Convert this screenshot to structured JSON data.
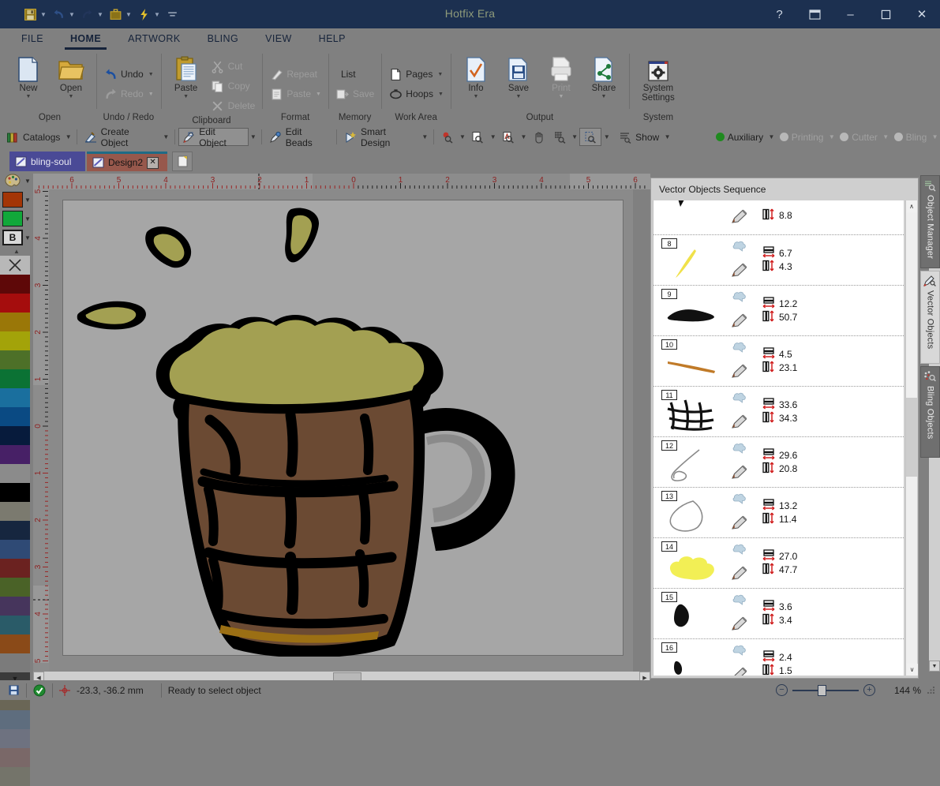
{
  "window": {
    "title": "Hotfix Era",
    "help_label": "?",
    "restore_down_label": "❐",
    "minimize_label": "–",
    "maximize_label": "☐",
    "close_label": "✕"
  },
  "quick_access": [
    {
      "name": "save",
      "icon": "floppy-disk-icon",
      "caret": true
    },
    {
      "name": "undo",
      "icon": "undo-arrow-icon",
      "caret": true
    },
    {
      "name": "redo",
      "icon": "redo-arrow-icon",
      "caret": true
    },
    {
      "name": "briefcase",
      "icon": "briefcase-icon",
      "caret": true
    },
    {
      "name": "quick-action",
      "icon": "lightning-bolt-icon",
      "caret": true
    },
    {
      "name": "customize",
      "icon": "customize-toolbar-icon",
      "caret": false
    }
  ],
  "ribbon_tabs": [
    {
      "label": "FILE",
      "active": false
    },
    {
      "label": "HOME",
      "active": true
    },
    {
      "label": "ARTWORK",
      "active": false
    },
    {
      "label": "BLING",
      "active": false
    },
    {
      "label": "VIEW",
      "active": false
    },
    {
      "label": "HELP",
      "active": false
    }
  ],
  "ribbon_groups": [
    {
      "label": "Open",
      "big_buttons": [
        {
          "label": "New",
          "icon": "new-document-icon",
          "caret": true,
          "disabled": false
        },
        {
          "label": "Open",
          "icon": "open-folder-icon",
          "caret": true,
          "disabled": false
        }
      ],
      "small_buttons": []
    },
    {
      "label": "Undo / Redo",
      "big_buttons": [],
      "small_buttons": [
        {
          "label": "Undo",
          "icon": "undo-arrow-icon",
          "caret": true,
          "disabled": false
        },
        {
          "label": "Redo",
          "icon": "redo-arrow-icon",
          "caret": true,
          "disabled": true
        }
      ]
    },
    {
      "label": "Clipboard",
      "big_buttons": [
        {
          "label": "Paste",
          "icon": "paste-clipboard-icon",
          "caret": true,
          "disabled": false
        }
      ],
      "small_buttons": [
        {
          "label": "Cut",
          "icon": "scissors-icon",
          "caret": false,
          "disabled": true
        },
        {
          "label": "Copy",
          "icon": "copy-pages-icon",
          "caret": false,
          "disabled": true
        },
        {
          "label": "Delete",
          "icon": "delete-x-icon",
          "caret": false,
          "disabled": true
        }
      ]
    },
    {
      "label": "Format",
      "big_buttons": [],
      "small_buttons": [
        {
          "label": "Repeat",
          "icon": "format-painter-icon",
          "caret": false,
          "disabled": true
        },
        {
          "label": "Paste",
          "icon": "paste-format-icon",
          "caret": true,
          "disabled": true
        }
      ]
    },
    {
      "label": "Memory",
      "big_buttons": [],
      "small_buttons": [
        {
          "label": "List",
          "icon": "memory-list-icon",
          "caret": false,
          "disabled": false
        },
        {
          "label": "Save",
          "icon": "memory-save-icon",
          "caret": false,
          "disabled": true
        }
      ]
    },
    {
      "label": "Work Area",
      "big_buttons": [],
      "small_buttons": [
        {
          "label": "Pages",
          "icon": "page-icon",
          "caret": true,
          "disabled": false
        },
        {
          "label": "Hoops",
          "icon": "hoop-icon",
          "caret": true,
          "disabled": false
        }
      ]
    },
    {
      "label": "Output",
      "big_buttons": [
        {
          "label": "Info",
          "icon": "info-check-icon",
          "caret": true,
          "disabled": false
        },
        {
          "label": "Save",
          "icon": "save-floppy-icon",
          "caret": true,
          "disabled": false
        },
        {
          "label": "Print",
          "icon": "printer-icon",
          "caret": true,
          "disabled": true
        },
        {
          "label": "Share",
          "icon": "share-node-icon",
          "caret": true,
          "disabled": false
        }
      ],
      "small_buttons": []
    },
    {
      "label": "System",
      "big_buttons": [
        {
          "label": "System Settings",
          "icon": "gear-settings-icon",
          "caret": false,
          "disabled": false
        }
      ],
      "small_buttons": []
    }
  ],
  "toolbar": {
    "items": [
      {
        "label": "Catalogs",
        "icon": "catalogs-icon",
        "caret": true,
        "active": false,
        "disabled": false
      },
      {
        "label": "Create Object",
        "icon": "create-object-icon",
        "caret": true,
        "active": false,
        "disabled": false
      },
      {
        "label": "Edit Object",
        "icon": "edit-object-icon",
        "caret": true,
        "active": true,
        "disabled": false
      },
      {
        "label": "Edit Beads",
        "icon": "edit-beads-icon",
        "caret": false,
        "active": false,
        "disabled": false
      },
      {
        "label": "Smart Design",
        "icon": "smart-design-icon",
        "caret": true,
        "active": false,
        "disabled": false
      }
    ],
    "zoom_tools": [
      {
        "name": "zoom-point-tool",
        "icon": "zoom-point-icon",
        "caret": true,
        "active": false
      },
      {
        "name": "zoom-page-tool",
        "icon": "zoom-page-icon",
        "caret": true,
        "active": false
      },
      {
        "name": "zoom-object-tool",
        "icon": "zoom-object-icon",
        "caret": true,
        "active": false
      },
      {
        "name": "pan-tool",
        "icon": "hand-pan-icon",
        "caret": false,
        "active": false
      },
      {
        "name": "zoom-grid-tool",
        "icon": "zoom-grid-icon",
        "caret": true,
        "active": false
      },
      {
        "name": "zoom-selection-tool",
        "icon": "zoom-selection-icon",
        "caret": true,
        "active": true
      }
    ],
    "show": {
      "label": "Show",
      "icon": "show-list-icon",
      "caret": true
    },
    "layers": [
      {
        "label": "Auxiliary",
        "color": "#1f8a1f",
        "caret": true,
        "disabled": false
      },
      {
        "label": "Printing",
        "color": "#b8b8b8",
        "caret": true,
        "disabled": true
      },
      {
        "label": "Cutter",
        "color": "#b8b8b8",
        "caret": true,
        "disabled": true
      },
      {
        "label": "Bling",
        "color": "#b8b8b8",
        "caret": true,
        "disabled": true
      }
    ]
  },
  "doc_tabs": [
    {
      "label": "bling-soul",
      "active": false,
      "closable": false,
      "color": "#4a4a96"
    },
    {
      "label": "Design2",
      "active": true,
      "closable": true,
      "color": "#97584c",
      "close_label": "✕"
    }
  ],
  "left_palette": {
    "top_controls": [
      {
        "name": "palette-picker",
        "icon": "color-palette-icon",
        "caret": true
      },
      {
        "name": "fill-color",
        "color": "#a33506",
        "caret": true
      },
      {
        "name": "outline-color",
        "color": "#11a83a",
        "caret": true
      },
      {
        "name": "text-color",
        "letter": "B",
        "caret": true
      }
    ],
    "scroll_up": "▲",
    "scroll_down": "▼",
    "no_color_label": "✕",
    "swatches": [
      "#5e0808",
      "#a50d0d",
      "#9a7708",
      "#a3a309",
      "#4d7028",
      "#0b7234",
      "#1a6f9e",
      "#0a4a83",
      "#071b3c",
      "#472066",
      "#8b8b8b",
      "#000000",
      "#7b7a6f",
      "#16263f",
      "#2f4a75",
      "#6b2220",
      "#4a6227",
      "#46355c",
      "#2a5b68",
      "#8a4a18",
      "#7b7b7b",
      "#3b3b3b",
      "#6a6656",
      "#5e6d7e",
      "#6e7280",
      "#7a6868",
      "#74746a"
    ]
  },
  "rulers": {
    "unit": "cm",
    "horizontal_ticks": [
      "6",
      "5",
      "4",
      "3",
      "2",
      "1",
      "0",
      "1",
      "2",
      "3",
      "4",
      "5",
      "6"
    ],
    "vertical_ticks": [
      "5",
      "4",
      "3",
      "2",
      "1",
      "0",
      "1",
      "2",
      "3",
      "4",
      "5"
    ]
  },
  "panel": {
    "title": "Vector Objects Sequence",
    "scroll_up": "∧",
    "scroll_down": "∨",
    "rows": [
      {
        "index": "",
        "thumb": "black-wedge",
        "color": "#111111",
        "width": "",
        "height": "8.8",
        "partial": true
      },
      {
        "index": "8",
        "thumb": "yellow-stroke",
        "color": "#f0e14a",
        "width": "6.7",
        "height": "4.3"
      },
      {
        "index": "9",
        "thumb": "black-blob",
        "color": "#111111",
        "width": "12.2",
        "height": "50.7"
      },
      {
        "index": "10",
        "thumb": "orange-stroke",
        "color": "#c07a28",
        "width": "4.5",
        "height": "23.1"
      },
      {
        "index": "11",
        "thumb": "black-grid",
        "color": "#111111",
        "width": "33.6",
        "height": "34.3"
      },
      {
        "index": "12",
        "thumb": "outline-hook",
        "color": "#8a8a8a",
        "width": "29.6",
        "height": "20.8"
      },
      {
        "index": "13",
        "thumb": "outline-leaf",
        "color": "#8a8a8a",
        "width": "13.2",
        "height": "11.4"
      },
      {
        "index": "14",
        "thumb": "yellow-foam",
        "color": "#f2ef55",
        "width": "27.0",
        "height": "47.7"
      },
      {
        "index": "15",
        "thumb": "black-shard",
        "color": "#111111",
        "width": "3.6",
        "height": "3.4"
      },
      {
        "index": "16",
        "thumb": "black-speck",
        "color": "#111111",
        "width": "2.4",
        "height": "1.5"
      }
    ],
    "width_icon": "width-dimension-icon",
    "height_icon": "height-dimension-icon",
    "visibility_icon": "cloud-visibility-icon",
    "edit_icon": "pencil-edit-icon"
  },
  "side_tabs": [
    {
      "label": "Object Manager",
      "icon": "object-manager-icon",
      "active": false
    },
    {
      "label": "Vector Objects",
      "icon": "vector-objects-icon",
      "active": true
    },
    {
      "label": "Bling Objects",
      "icon": "bling-objects-icon",
      "active": false
    }
  ],
  "status": {
    "save_icon": "floppy-disk-icon",
    "ok_icon": "green-check-icon",
    "crosshair_icon": "crosshair-icon",
    "coordinates": "-23.3, -36.2 mm",
    "message": "Ready to select object",
    "zoom_out_label": "−",
    "zoom_in_label": "+",
    "zoom_level": "144 %"
  },
  "artwork": {
    "name": "beer-mug-illustration",
    "foam_color": "#a3a052",
    "mug_color": "#6b4a33",
    "outline_color": "#000000",
    "band_color": "#9b6f14",
    "background_color": "#a6a6a6"
  }
}
